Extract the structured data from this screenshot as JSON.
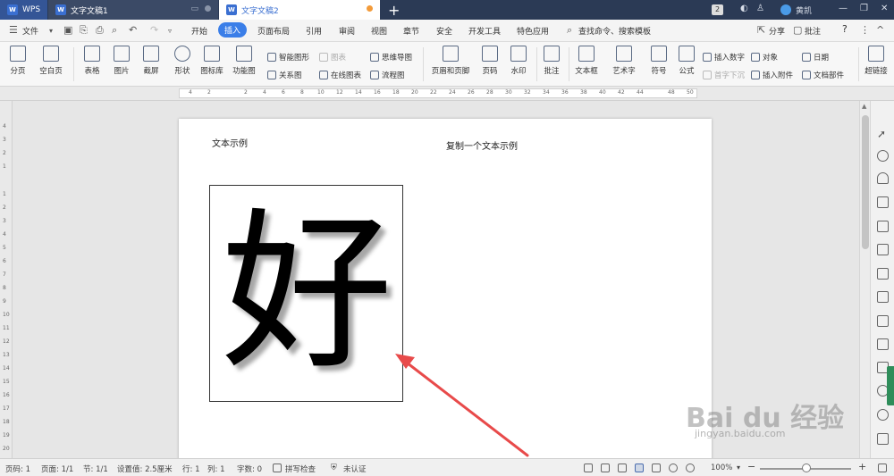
{
  "titlebar": {
    "app_tab": "WPS",
    "tabs": [
      {
        "label": "文字文稿1"
      },
      {
        "label": "文字文稿2"
      }
    ],
    "new_tab": "+",
    "badge": "2",
    "user_name": "黄凯",
    "window_controls": [
      "—",
      "❐",
      "✕"
    ]
  },
  "menubar": {
    "file_menu": "文件",
    "items": [
      "开始",
      "插入",
      "页面布局",
      "引用",
      "审阅",
      "视图",
      "章节",
      "安全",
      "开发工具",
      "特色应用"
    ],
    "active_item": "插入",
    "search": "查找命令、搜索模板",
    "share": "分享",
    "comment": "批注",
    "help": "?"
  },
  "ribbon": {
    "page_break": "分页",
    "blank_page": "空白页",
    "table": "表格",
    "picture": "图片",
    "screenshot": "截屏",
    "shape": "形状",
    "icon_lib": "图标库",
    "function_chart": "功能图",
    "smart_shape": "智能图形",
    "chart": "图表",
    "mind_map": "思维导图",
    "relation_chart": "关系图",
    "online_chart": "在线图表",
    "flow_chart": "流程图",
    "header_footer": "页眉和页脚",
    "page_number": "页码",
    "watermark": "水印",
    "comment": "批注",
    "text_box": "文本框",
    "art_text": "艺术字",
    "symbol": "符号",
    "formula": "公式",
    "insert_number": "插入数字",
    "drop_cap": "首字下沉",
    "object": "对象",
    "attachment": "插入附件",
    "date": "日期",
    "doc_parts": "文档部件",
    "hyperlink": "超链接"
  },
  "ruler": {
    "h_labels": [
      "4",
      "2",
      "2",
      "4",
      "6",
      "8",
      "10",
      "12",
      "14",
      "16",
      "18",
      "20",
      "22",
      "24",
      "26",
      "28",
      "30",
      "32",
      "34",
      "36",
      "38",
      "40",
      "42",
      "44",
      "48",
      "50"
    ],
    "v_labels": [
      "4",
      "3",
      "2",
      "1",
      "1",
      "2",
      "3",
      "4",
      "5",
      "6",
      "7",
      "8",
      "9",
      "10",
      "11",
      "12",
      "13",
      "14",
      "15",
      "16",
      "17",
      "18",
      "19",
      "20"
    ]
  },
  "document": {
    "text_left": "文本示例",
    "text_right": "复制一个文本示例",
    "image_char": "好"
  },
  "watermark": {
    "logo": "Bai du 经验",
    "url": "jingyan.baidu.com"
  },
  "statusbar": {
    "page_num": "页码: 1",
    "pages": "页面: 1/1",
    "section": "节: 1/1",
    "setting": "设置值: 2.5厘米",
    "row": "行: 1",
    "col": "列: 1",
    "word_count": "字数: 0",
    "spell_check": "拼写检查",
    "auth": "未认证",
    "zoom": "100%",
    "zoom_minus": "−",
    "zoom_plus": "+"
  },
  "colors": {
    "accent": "#3a7ee8",
    "arrow": "#e84a4a",
    "title_bg": "#2b3a55"
  }
}
